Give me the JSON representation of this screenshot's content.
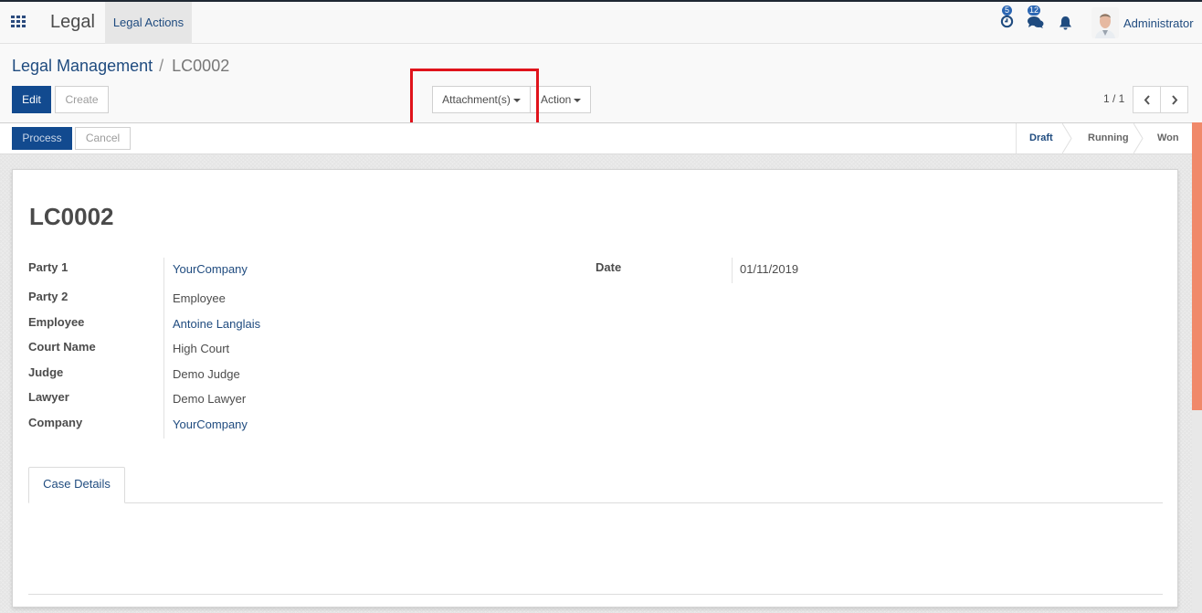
{
  "navbar": {
    "app_name": "Legal",
    "menu_items": [
      {
        "label": "Legal Actions"
      }
    ],
    "activities_count": "5",
    "messages_count": "12",
    "user_name": "Administrator"
  },
  "breadcrumb": {
    "parent": "Legal Management",
    "separator": "/",
    "current": "LC0002"
  },
  "toolbar": {
    "edit_label": "Edit",
    "create_label": "Create",
    "attachments_label": "Attachment(s)",
    "action_label": "Action",
    "pager_value": "1 / 1"
  },
  "statusbar": {
    "process_label": "Process",
    "cancel_label": "Cancel",
    "stages": [
      {
        "label": "Draft",
        "active": true
      },
      {
        "label": "Running",
        "active": false
      },
      {
        "label": "Won",
        "active": false
      }
    ]
  },
  "record": {
    "title": "LC0002",
    "fields_left": [
      {
        "label": "Party 1",
        "value": "YourCompany",
        "link": true
      },
      {
        "label": "Party 2",
        "value": "Employee",
        "link": false
      },
      {
        "label": "Employee",
        "value": "Antoine Langlais",
        "link": true
      },
      {
        "label": "Court Name",
        "value": "High Court",
        "link": false
      },
      {
        "label": "Judge",
        "value": "Demo Judge",
        "link": false
      },
      {
        "label": "Lawyer",
        "value": "Demo Lawyer",
        "link": false
      },
      {
        "label": "Company",
        "value": "YourCompany",
        "link": true
      }
    ],
    "fields_right": [
      {
        "label": "Date",
        "value": "01/11/2019"
      }
    ]
  },
  "tabs": [
    {
      "label": "Case Details"
    }
  ],
  "colors": {
    "primary": "#124a8f",
    "link": "#1f4b7f",
    "highlight": "#e0131b",
    "scroll_thumb": "#f0896a"
  }
}
